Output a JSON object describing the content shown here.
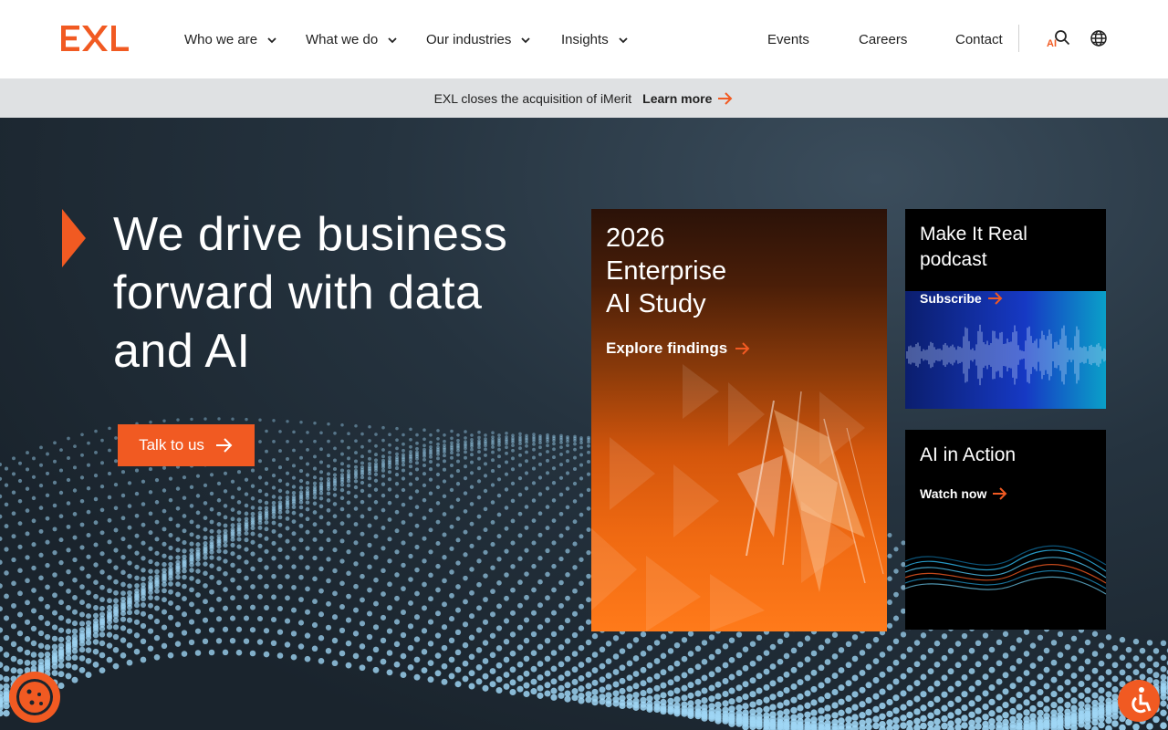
{
  "brand": {
    "logo_text": "EXL",
    "accent": "#f15a22"
  },
  "nav": {
    "items": [
      {
        "label": "Who we are"
      },
      {
        "label": "What we do"
      },
      {
        "label": "Our industries"
      },
      {
        "label": "Insights"
      }
    ],
    "right": [
      {
        "label": "Events"
      },
      {
        "label": "Careers"
      },
      {
        "label": "Contact"
      }
    ],
    "ai_search_label": "AI",
    "icons": [
      "search-icon",
      "globe-icon",
      "chevron-down-icon"
    ]
  },
  "announcement": {
    "text": "EXL closes the acquisition of iMerit",
    "link": "Learn more"
  },
  "hero": {
    "headline": "We drive business forward with data and AI",
    "cta": "Talk to us"
  },
  "cards": {
    "study": {
      "title_line1": "2026",
      "title_line2": "Enterprise",
      "title_line3": "AI Study",
      "link": "Explore findings"
    },
    "podcast": {
      "title_line1": "Make It Real",
      "title_line2": "podcast",
      "link": "Subscribe"
    },
    "action": {
      "title": "AI in Action",
      "link": "Watch now"
    }
  },
  "floating": {
    "cookie_icon": "cookie-icon",
    "accessibility_icon": "accessibility-icon"
  }
}
